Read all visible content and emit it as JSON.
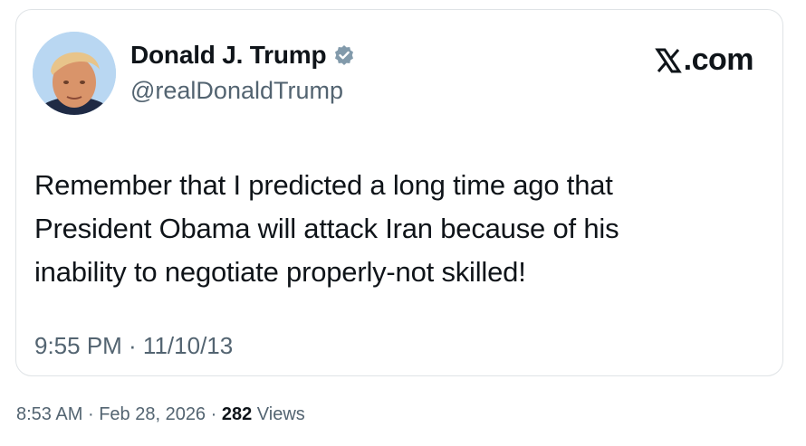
{
  "card": {
    "author": {
      "name": "Donald J. Trump",
      "handle": "@realDonaldTrump",
      "avatar": "avatar-photo",
      "verified_icon": "verified-badge-icon",
      "verified_color": "#829aab"
    },
    "brand": {
      "icon": "x-logo-icon",
      "suffix": ".com"
    },
    "text_lines": [
      "Remember that I predicted a long time ago that",
      "President Obama will attack Iran because of his",
      "inability to negotiate properly-not skilled!"
    ],
    "timestamp": "9:55 PM · 11/10/13"
  },
  "post_meta": {
    "time": "8:53 AM",
    "separator": "·",
    "date": "Feb 28, 2026",
    "views_count": "282",
    "views_label": "Views"
  },
  "colors": {
    "text_primary": "#0f1419",
    "text_secondary": "#536471",
    "border": "#dfe3e6"
  }
}
